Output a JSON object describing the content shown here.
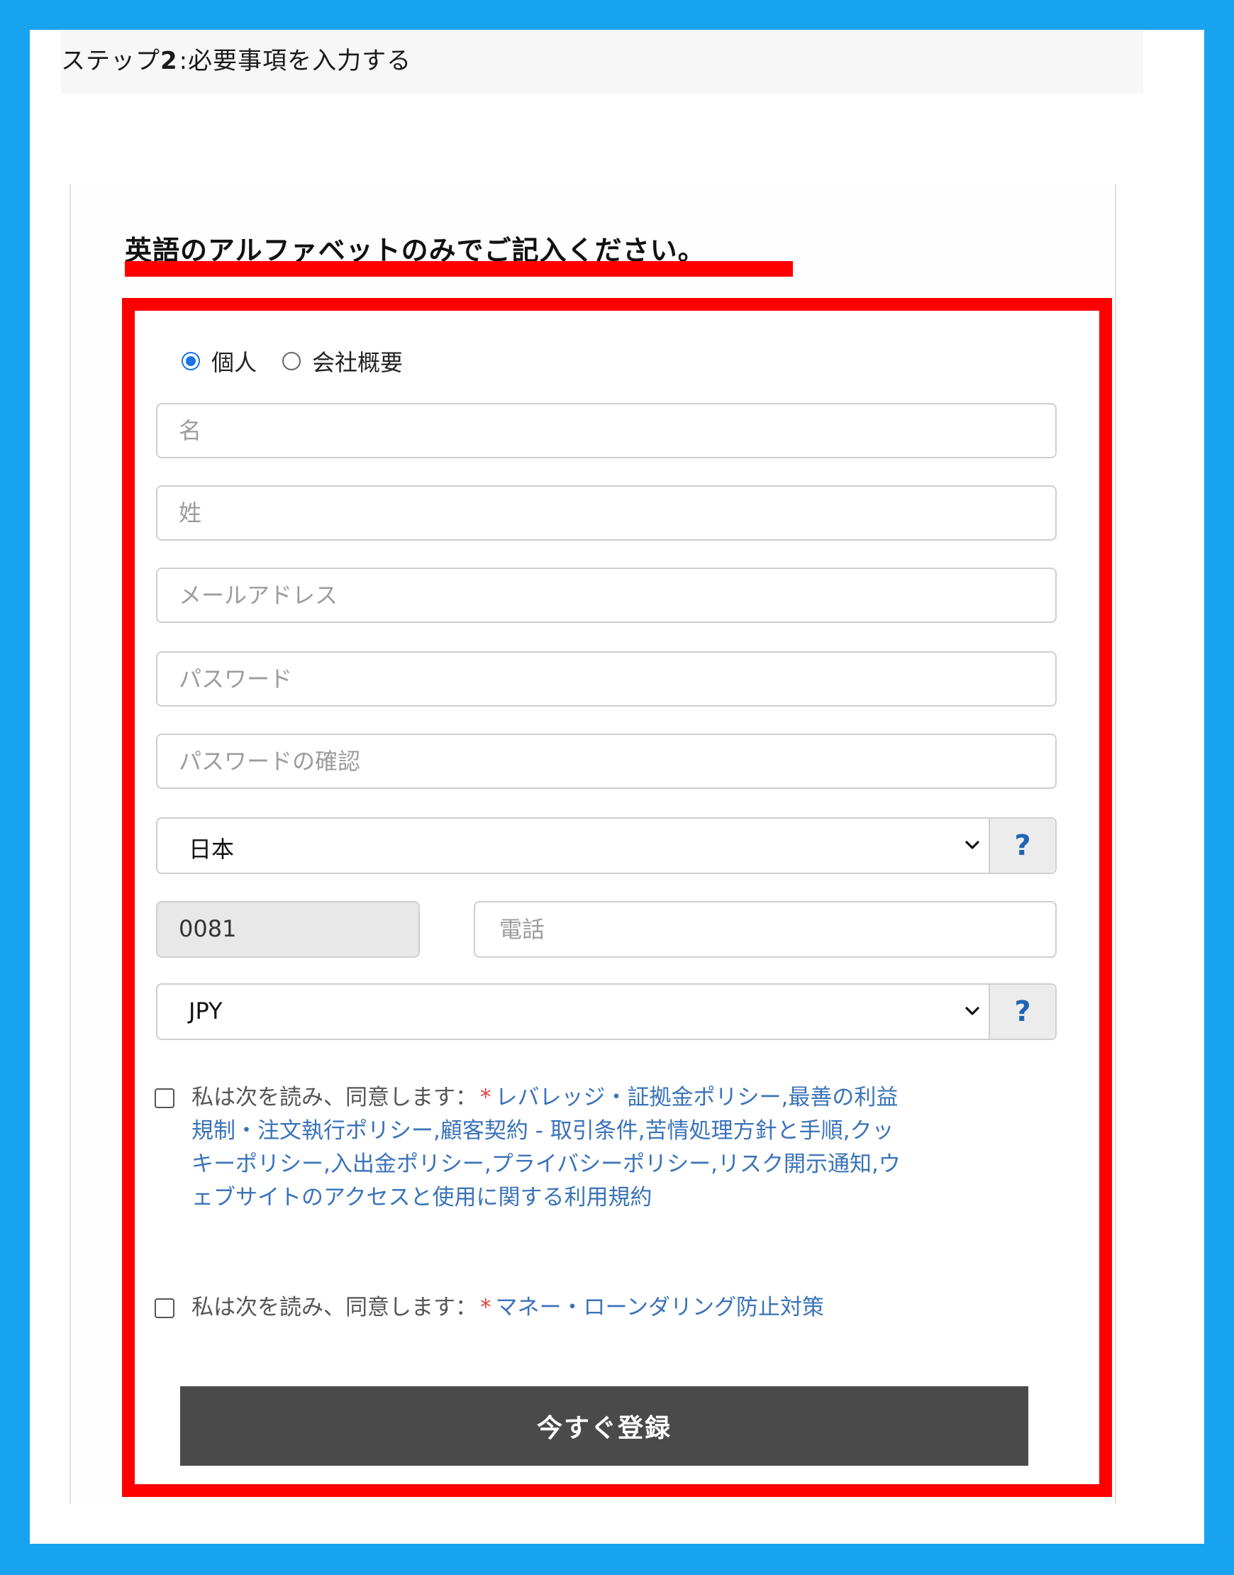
{
  "step": {
    "prefix": "ステップ",
    "number": "2",
    "text": ":必要事項を入力する"
  },
  "notice": "英語のアルファベットのみでご記入ください。",
  "account_type": {
    "options": [
      "個人",
      "会社概要"
    ],
    "selected": "個人"
  },
  "fields": {
    "first_name_placeholder": "名",
    "last_name_placeholder": "姓",
    "email_placeholder": "メールアドレス",
    "password_placeholder": "パスワード",
    "password_confirm_placeholder": "パスワードの確認",
    "phone_placeholder": "電話"
  },
  "country": {
    "selected": "日本",
    "help_label": "?"
  },
  "phone_code": "0081",
  "currency": {
    "selected": "JPY",
    "help_label": "?"
  },
  "consent1": {
    "prefix": "私は次を読み、同意します：",
    "star": "*",
    "link_text": "レバレッジ・証拠金ポリシー,最善の利益規制・注文執行ポリシー,顧客契約 - 取引条件,苦情処理方針と手順,クッキーポリシー,入出金ポリシー,プライバシーポリシー,リスク開示通知,ウェブサイトのアクセスと使用に関する利用規約"
  },
  "consent2": {
    "prefix": "私は次を読み、同意します：",
    "star": "*",
    "link_text": "マネー・ローンダリング防止対策"
  },
  "submit_label": "今すぐ登録",
  "colors": {
    "background": "#17a3ee",
    "highlight": "#ff0000",
    "link": "#3a73b8",
    "radio_selected": "#1a73e8",
    "button": "#4a4a4a"
  }
}
